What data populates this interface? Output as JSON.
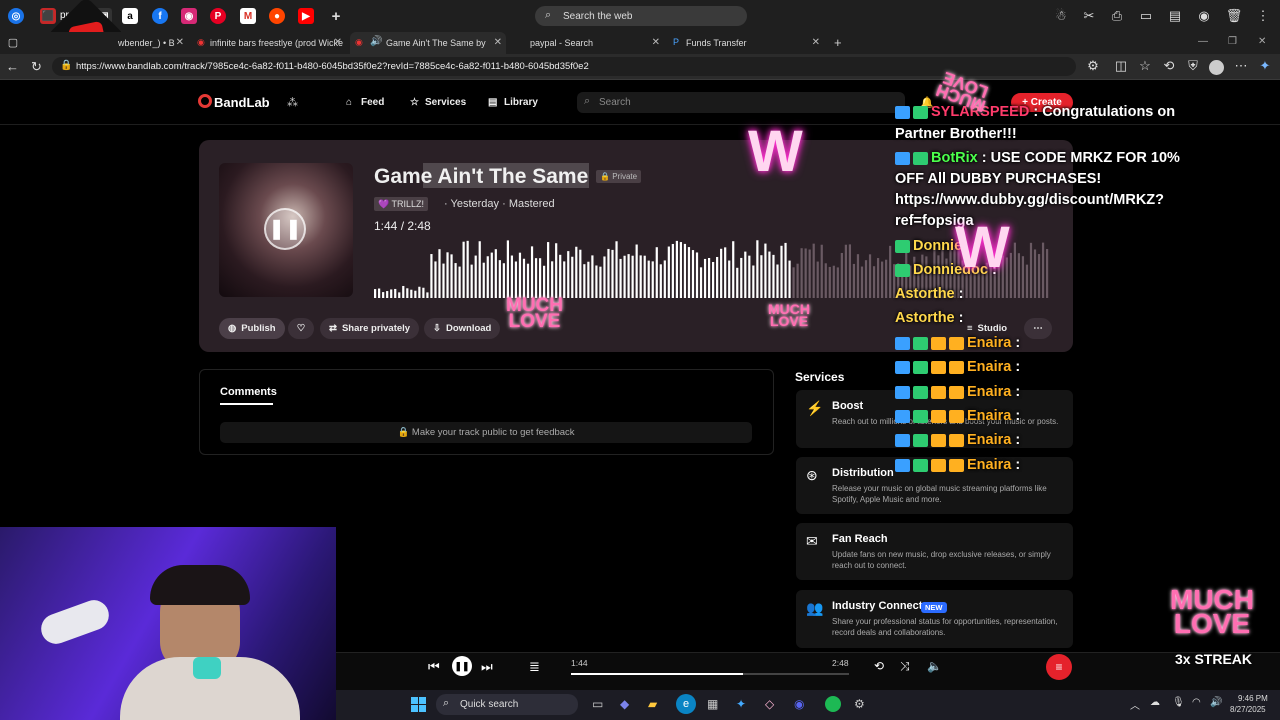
{
  "browser": {
    "search_placeholder": "Search the web",
    "tabs": [
      {
        "label": "wbender_) • B"
      },
      {
        "label": "infinite bars freestlye (prod Wicke"
      },
      {
        "label": "Game Ain't The Same by"
      },
      {
        "label": "paypal - Search"
      },
      {
        "label": "Funds Transfer"
      }
    ],
    "url": "https://www.bandlab.com/track/7985ce4c-6a82-f011-b480-6045bd35f0e2?revId=7885ce4c-6a82-f011-b480-6045bd35f0e2",
    "pinned_label": "pr"
  },
  "bandlab": {
    "logo": "BandLab",
    "nav": {
      "feed": "Feed",
      "services": "Services",
      "library": "Library"
    },
    "search_placeholder": "Search",
    "create": "Create",
    "track": {
      "title": "Game Ain't The Same",
      "privacy": "Private",
      "artist": "TRILLZ!",
      "meta": "· Yesterday · Mastered",
      "time": "1:44 / 2:48",
      "progress": 0.62
    },
    "actions": {
      "publish": "Publish",
      "share": "Share privately",
      "download": "Download",
      "studio": "Studio"
    },
    "comments": {
      "heading": "Comments",
      "notice": "Make your track public to get feedback"
    },
    "services": {
      "heading": "Services",
      "items": [
        {
          "title": "Boost",
          "desc": "Reach out to millions of listeners and boost your music or posts."
        },
        {
          "title": "Distribution",
          "desc": "Release your music on global music streaming platforms like Spotify, Apple Music and more."
        },
        {
          "title": "Fan Reach",
          "desc": "Update fans on new music, drop exclusive releases, or simply reach out to connect."
        },
        {
          "title": "Industry Connect",
          "badge": "NEW",
          "desc": "Share your professional status for opportunities, representation, record deals and collaborations."
        }
      ]
    },
    "player": {
      "elapsed": "1:44",
      "total": "2:48"
    }
  },
  "chat": [
    {
      "user": "SYLARSPEED",
      "msg": ": Congratulations on",
      "color": "#ff3b6b"
    },
    {
      "user": "",
      "msg": "Partner Brother!!!",
      "color": "#fff"
    },
    {
      "user": "BotRix",
      "msg": ": USE CODE MRKZ FOR 10%",
      "color": "#4cff4c"
    },
    {
      "user": "",
      "msg": "OFF All DUBBY PURCHASES!",
      "color": "#fff"
    },
    {
      "user": "",
      "msg": "https://www.dubby.gg/discount/MRKZ?",
      "color": "#fff"
    },
    {
      "user": "",
      "msg": "ref=fopsiga",
      "color": "#fff"
    },
    {
      "user": "Donnie",
      "msg": "",
      "color": "#ffd84c"
    },
    {
      "user": "Donniedoc",
      "msg": ":",
      "color": "#ffd84c"
    },
    {
      "user": "Astorthe",
      "msg": ":",
      "color": "#ffd84c"
    },
    {
      "user": "Astorthe",
      "msg": ":",
      "color": "#ffd84c"
    },
    {
      "user": "Enaira",
      "msg": ":",
      "color": "#ffb020"
    },
    {
      "user": "Enaira",
      "msg": ":",
      "color": "#ffb020"
    },
    {
      "user": "Enaira",
      "msg": ":",
      "color": "#ffb020"
    },
    {
      "user": "Enaira",
      "msg": ":",
      "color": "#ffb020"
    },
    {
      "user": "Enaira",
      "msg": ":",
      "color": "#ffb020"
    },
    {
      "user": "Enaira",
      "msg": ":",
      "color": "#ffb020"
    }
  ],
  "overlay": {
    "much": "MUCH",
    "love": "LOVE",
    "w": "W",
    "streak": "3x STREAK"
  },
  "taskbar": {
    "search": "Quick search",
    "time": "9:46 PM",
    "date": "8/27/2025"
  }
}
